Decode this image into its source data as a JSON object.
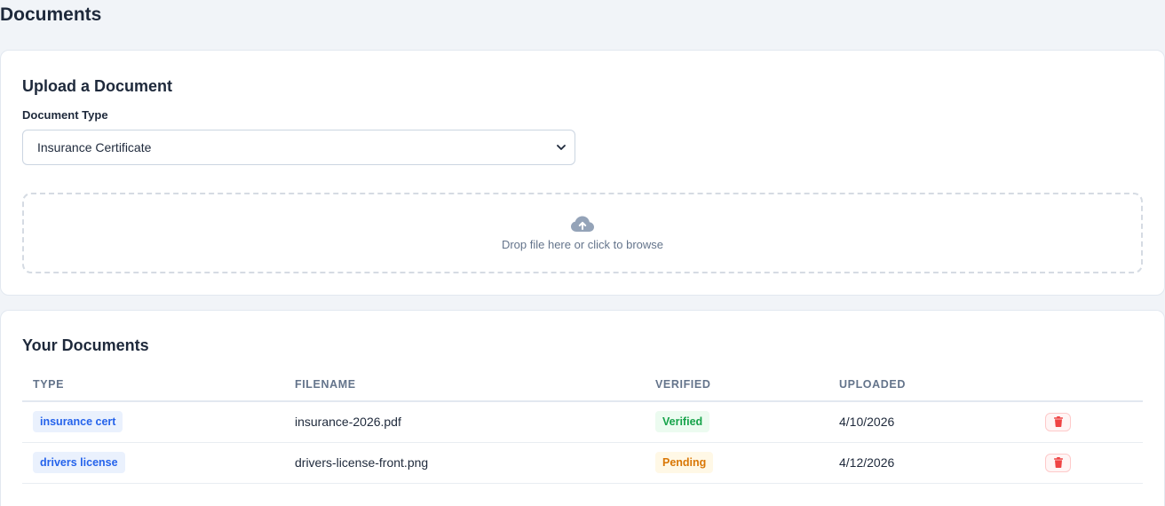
{
  "page": {
    "title": "Documents"
  },
  "upload": {
    "title": "Upload a Document",
    "type_label": "Document Type",
    "selected_type": "Insurance Certificate",
    "dropzone_text": "Drop file here or click to browse",
    "icon": "cloud-upload-icon"
  },
  "documents": {
    "title": "Your Documents",
    "columns": [
      "TYPE",
      "FILENAME",
      "VERIFIED",
      "UPLOADED"
    ],
    "rows": [
      {
        "type": "insurance cert",
        "filename": "insurance-2026.pdf",
        "status": "Verified",
        "uploaded": "4/10/2026"
      },
      {
        "type": "drivers license",
        "filename": "drivers-license-front.png",
        "status": "Pending",
        "uploaded": "4/12/2026"
      }
    ]
  },
  "colors": {
    "accent": "#2563eb",
    "verified": "#16a34a",
    "pending": "#d97706",
    "danger": "#ef4444"
  }
}
